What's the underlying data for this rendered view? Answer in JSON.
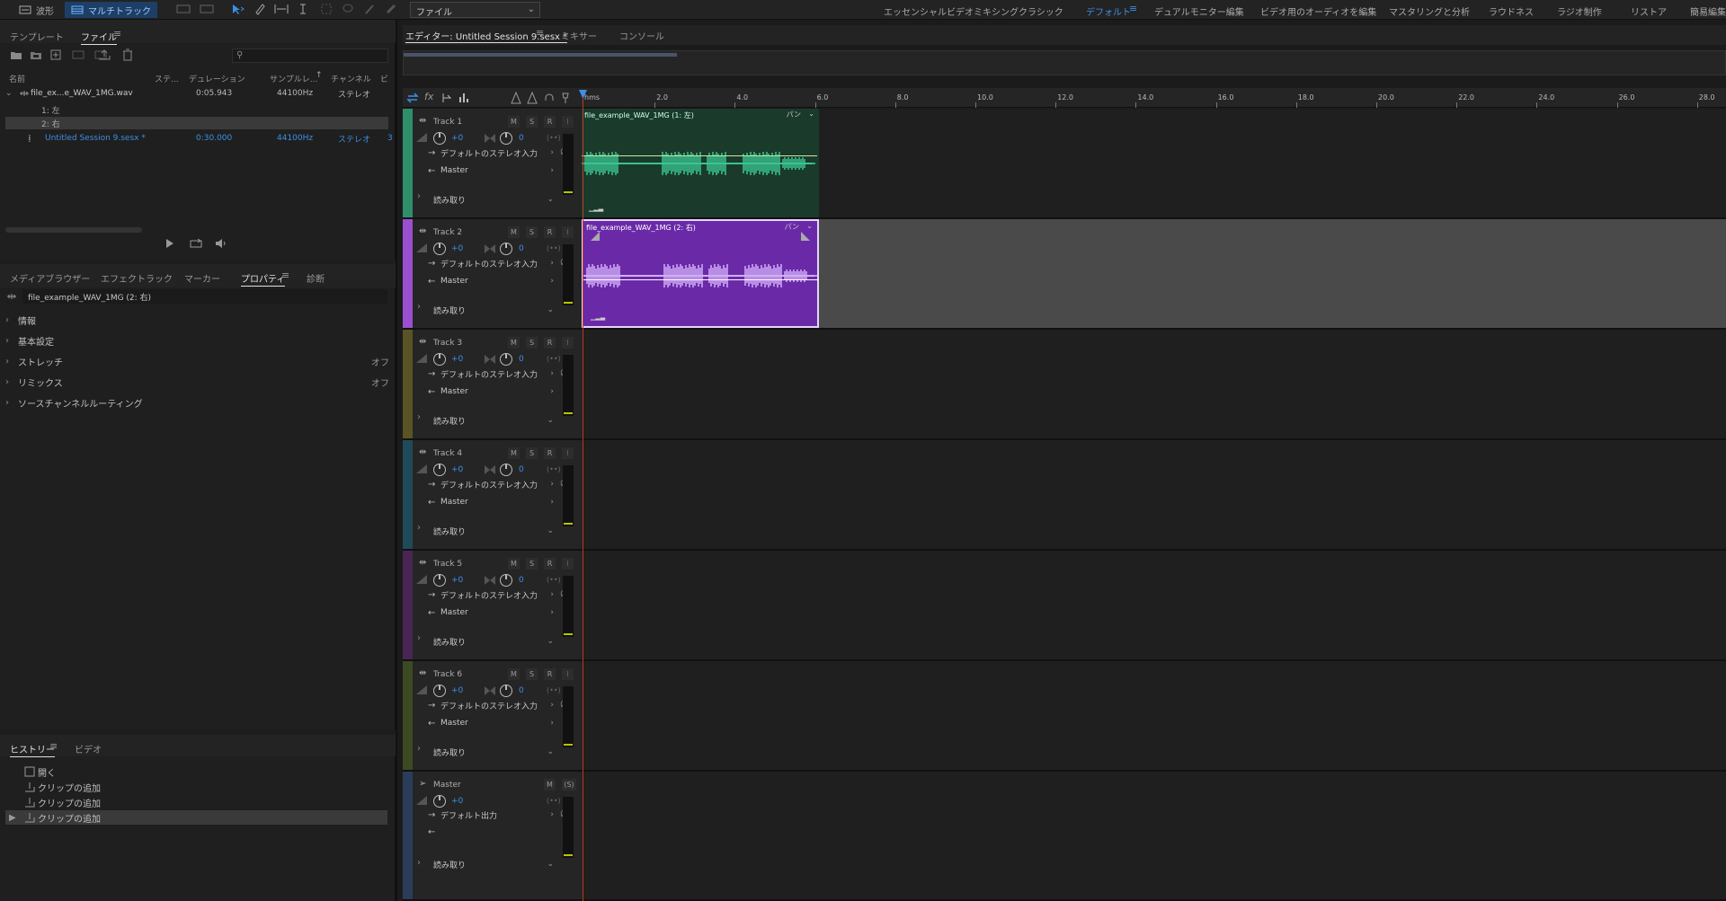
{
  "topbar": {
    "mode_waveform": "波形",
    "mode_multitrack": "マルチトラック",
    "file_select": "ファイル",
    "workspaces": [
      "エッセンシャルビデオミキシング",
      "クラシック",
      "デフォルト",
      "デュアルモニター編集",
      "ビデオ用のオーディオを編集",
      "マスタリングと分析",
      "ラウドネス",
      "ラジオ制作",
      "リストア",
      "簡易編集"
    ],
    "active_workspace": "デフォルト"
  },
  "files_panel": {
    "tabs": [
      "テンプレート",
      "ファイル"
    ],
    "active_tab": "ファイル",
    "columns": {
      "name": "名前",
      "status": "ステ...",
      "duration": "デュレーション",
      "samplerate": "サンプルレ...",
      "channels": "チャンネル",
      "bit": "ビ"
    },
    "files": [
      {
        "name": "file_ex...e_WAV_1MG.wav",
        "duration": "0:05.943",
        "samplerate": "44100Hz",
        "channels": "ステレオ"
      },
      {
        "name": "1: 左"
      },
      {
        "name": "2: 右"
      },
      {
        "name": "Untitled Session 9.sesx *",
        "duration": "0:30.000",
        "samplerate": "44100Hz",
        "channels": "ステレオ",
        "bit": "3"
      }
    ]
  },
  "properties_panel": {
    "tabs": [
      "メディアブラウザー",
      "エフェクトラック",
      "マーカー",
      "プロパティ",
      "診断"
    ],
    "active_tab": "プロパティ",
    "clip_name": "file_example_WAV_1MG (2: 右)",
    "sections": [
      {
        "label": "情報",
        "value": ""
      },
      {
        "label": "基本設定",
        "value": ""
      },
      {
        "label": "ストレッチ",
        "value": "オフ"
      },
      {
        "label": "リミックス",
        "value": "オフ"
      },
      {
        "label": "ソースチャンネルルーティング",
        "value": ""
      }
    ]
  },
  "history_panel": {
    "tabs": [
      "ヒストリー",
      "ビデオ"
    ],
    "active_tab": "ヒストリー",
    "items": [
      "開く",
      "クリップの追加",
      "クリップの追加",
      "クリップの追加"
    ]
  },
  "editor": {
    "tabs": [
      "エディター: Untitled Session 9.sesx *",
      "ミキサー",
      "コンソール"
    ],
    "active_tab": "エディター: Untitled Session 9.sesx *",
    "ruler_ticks": [
      "hms",
      "2.0",
      "4.0",
      "6.0",
      "8.0",
      "10.0",
      "12.0",
      "14.0",
      "16.0",
      "18.0",
      "20.0",
      "22.0",
      "24.0",
      "26.0",
      "28.0"
    ],
    "tracks": [
      {
        "name": "Track 1",
        "volume": "+0",
        "pan": "0",
        "input": "デフォルトのステレオ入力",
        "output": "Master",
        "automation": "読み取り",
        "color": "#2f8f6a",
        "clip": "file_example_WAV_1MG (1: 左)",
        "clip_pan": "パン",
        "clip_type": "green"
      },
      {
        "name": "Track 2",
        "volume": "+0",
        "pan": "0",
        "input": "デフォルトのステレオ入力",
        "output": "Master",
        "automation": "読み取り",
        "color": "#9a4fd0",
        "clip": "file_example_WAV_1MG (2: 右)",
        "clip_pan": "パン",
        "clip_type": "purple"
      },
      {
        "name": "Track 3",
        "volume": "+0",
        "pan": "0",
        "input": "デフォルトのステレオ入力",
        "output": "Master",
        "automation": "読み取り",
        "color": "#5a5424"
      },
      {
        "name": "Track 4",
        "volume": "+0",
        "pan": "0",
        "input": "デフォルトのステレオ入力",
        "output": "Master",
        "automation": "読み取り",
        "color": "#1f4a5a"
      },
      {
        "name": "Track 5",
        "volume": "+0",
        "pan": "0",
        "input": "デフォルトのステレオ入力",
        "output": "Master",
        "automation": "読み取り",
        "color": "#4a2454"
      },
      {
        "name": "Track 6",
        "volume": "+0",
        "pan": "0",
        "input": "デフォルトのステレオ入力",
        "output": "Master",
        "automation": "読み取り",
        "color": "#3c4a22"
      }
    ],
    "master": {
      "name": "Master",
      "volume": "+0",
      "output": "デフォルト出力",
      "automation": "読み取り",
      "color": "#2a3c5a"
    },
    "msr": {
      "m": "M",
      "s": "S",
      "r": "R",
      "solo_master": "(S)"
    }
  }
}
